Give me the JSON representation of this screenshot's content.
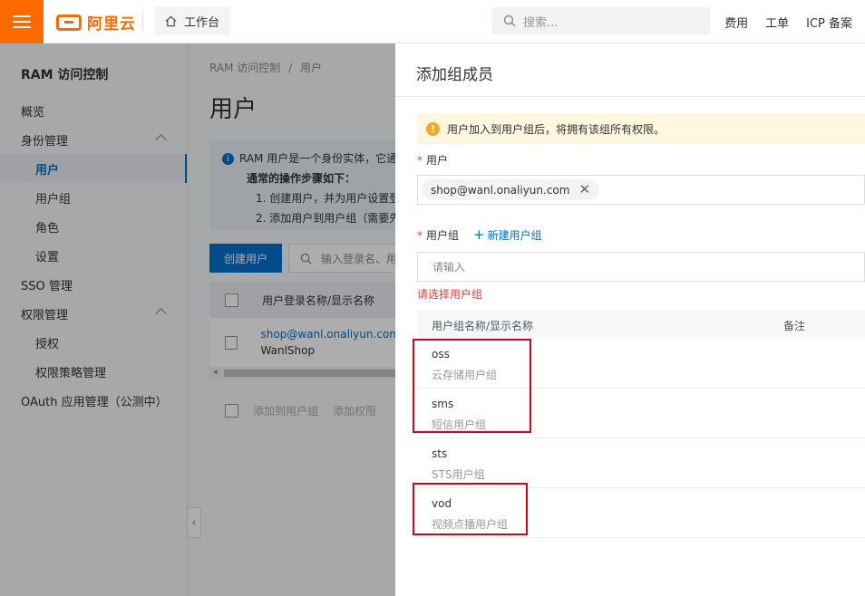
{
  "topbar": {
    "logo_text": "阿里云",
    "workbench": "工作台",
    "search_placeholder": "搜索...",
    "links": [
      "费用",
      "工单",
      "ICP 备案"
    ]
  },
  "sidebar": {
    "title": "RAM 访问控制",
    "items": [
      {
        "label": "概览"
      },
      {
        "label": "身份管理"
      },
      {
        "label": "用户"
      },
      {
        "label": "用户组"
      },
      {
        "label": "角色"
      },
      {
        "label": "设置"
      },
      {
        "label": "SSO 管理"
      },
      {
        "label": "权限管理"
      },
      {
        "label": "授权"
      },
      {
        "label": "权限策略管理"
      },
      {
        "label": "OAuth 应用管理（公测中）"
      }
    ]
  },
  "main": {
    "breadcrumb": [
      "RAM 访问控制",
      "/",
      "用户"
    ],
    "title": "用户",
    "info": {
      "line1": "RAM 用户是一个身份实体，它通",
      "line2": "通常的操作步骤如下：",
      "line3": "1. 创建用户，并为用户设置登",
      "line4": "2. 添加用户到用户组（需要先"
    },
    "create_button": "创建用户",
    "search_placeholder": "输入登录名、用",
    "table_header": "用户登录名称/显示名称",
    "row": {
      "login": "shop@wanl.onaliyun.com",
      "display": "WanlShop"
    },
    "bulk": [
      "添加到用户组",
      "添加权限"
    ]
  },
  "drawer": {
    "title": "添加组成员",
    "alert": "用户加入到用户组后，将拥有该组所有权限。",
    "user_label": "用户",
    "user_tag": "shop@wanl.onaliyun.com",
    "group_label": "用户组",
    "new_group": "新建用户组",
    "group_placeholder": "请输入",
    "error": "请选择用户组",
    "columns": [
      "用户组名称/显示名称",
      "备注"
    ],
    "groups": [
      {
        "name": "oss",
        "display": "云存储用户组"
      },
      {
        "name": "sms",
        "display": "短信用户组"
      },
      {
        "name": "sts",
        "display": "STS用户组"
      },
      {
        "name": "vod",
        "display": "视频点播用户组"
      }
    ]
  },
  "colors": {
    "brand": "#ff6a00",
    "accent": "#0070cc",
    "error": "#e23c39",
    "highlight": "#d0021b"
  }
}
